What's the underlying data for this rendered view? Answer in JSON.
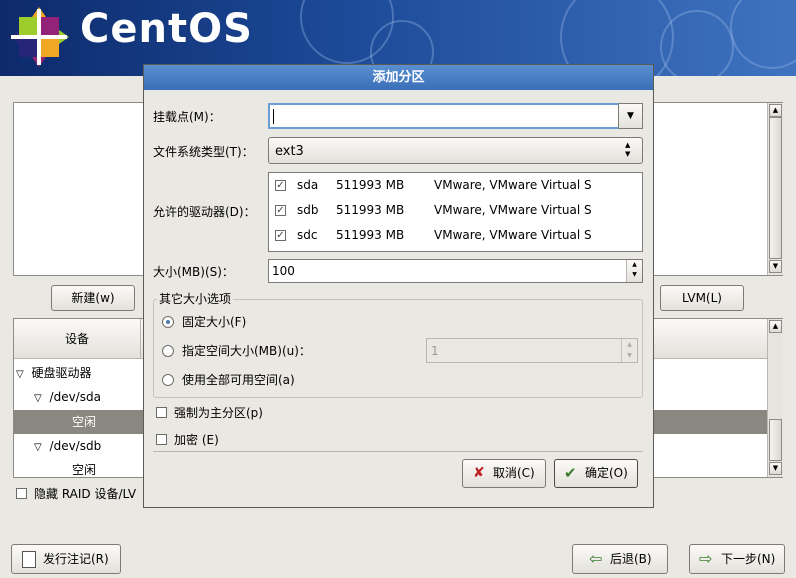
{
  "banner": {
    "brand": "CentOS"
  },
  "background": {
    "new_button": "新建(w)",
    "lvm_button": "LVM(L)",
    "device_header": "设备",
    "tree": [
      {
        "label": "硬盘驱动器"
      },
      {
        "label": "/dev/sda"
      },
      {
        "label": "空闲"
      },
      {
        "label": "/dev/sdb"
      },
      {
        "label": "空闲"
      }
    ],
    "hide_raid_label": "隐藏 RAID 设备/LV",
    "release_notes_button": "发行注记(R)",
    "back_button": "后退(B)",
    "next_button": "下一步(N)"
  },
  "dialog": {
    "title": "添加分区",
    "mount_point_label": "挂载点(M)：",
    "mount_point_value": "",
    "fs_type_label": "文件系统类型(T)：",
    "fs_type_value": "ext3",
    "drives_label": "允许的驱动器(D)：",
    "drives": [
      {
        "name": "sda",
        "size": "511993 MB",
        "model": "VMware, VMware Virtual S",
        "checked": true
      },
      {
        "name": "sdb",
        "size": "511993 MB",
        "model": "VMware, VMware Virtual S",
        "checked": true
      },
      {
        "name": "sdc",
        "size": "511993 MB",
        "model": "VMware, VMware Virtual S",
        "checked": true
      }
    ],
    "size_label": "大小(MB)(S)：",
    "size_value": "100",
    "other_options_title": "其它大小选项",
    "options": {
      "fixed": "固定大小(F)",
      "up_to": "指定空间大小(MB)(u)：",
      "up_to_value": "1",
      "fill": "使用全部可用空间(a)",
      "selected": "fixed"
    },
    "force_primary_label": "强制为主分区(p)",
    "encrypt_label": "加密 (E)",
    "cancel_button": "取消(C)",
    "ok_button": "确定(O)"
  },
  "colors": {
    "accent": "#3a6fb8",
    "selection": "#8a8780",
    "banner": "#1d4b99"
  }
}
